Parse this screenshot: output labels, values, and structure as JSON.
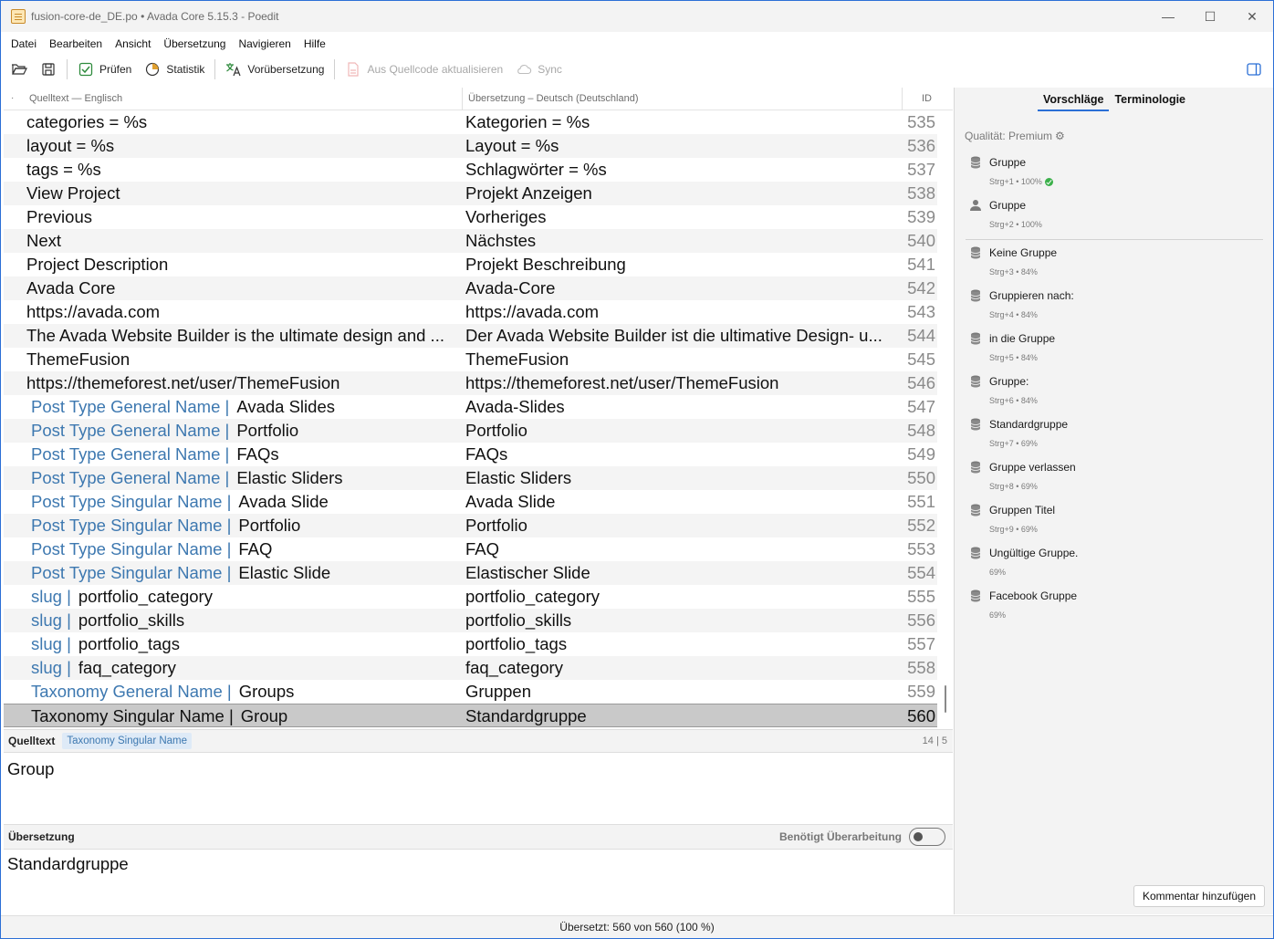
{
  "window": {
    "title": "fusion-core-de_DE.po • Avada Core 5.15.3 - Poedit",
    "controls": {
      "minimize": "—",
      "maximize": "☐",
      "close": "✕"
    }
  },
  "menu": [
    "Datei",
    "Bearbeiten",
    "Ansicht",
    "Übersetzung",
    "Navigieren",
    "Hilfe"
  ],
  "toolbar": {
    "open": {
      "icon": "folder-open-icon"
    },
    "save": {
      "icon": "save-icon"
    },
    "check": {
      "label": "Prüfen",
      "icon": "check-icon"
    },
    "stats": {
      "label": "Statistik",
      "icon": "pie-chart-icon"
    },
    "pretranslate": {
      "label": "Vorübersetzung",
      "icon": "translate-icon"
    },
    "update": {
      "label": "Aus Quellcode aktualisieren",
      "icon": "document-update-icon"
    },
    "sync": {
      "label": "Sync",
      "icon": "cloud-sync-icon"
    },
    "sidebar_toggle": {
      "icon": "sidebar-toggle-icon"
    }
  },
  "list": {
    "headers": {
      "dot": "·",
      "source": "Quelltext — Englisch",
      "translation": "Übersetzung – Deutsch (Deutschland)",
      "id": "ID"
    },
    "rows": [
      {
        "ctx": "",
        "src": "categories = %s",
        "trn": "Kategorien = %s",
        "id": "535"
      },
      {
        "ctx": "",
        "src": "layout = %s",
        "trn": "Layout = %s",
        "id": "536"
      },
      {
        "ctx": "",
        "src": "tags = %s",
        "trn": "Schlagwörter = %s",
        "id": "537"
      },
      {
        "ctx": "",
        "src": "View Project",
        "trn": "Projekt Anzeigen",
        "id": "538"
      },
      {
        "ctx": "",
        "src": "Previous",
        "trn": "Vorheriges",
        "id": "539"
      },
      {
        "ctx": "",
        "src": "Next",
        "trn": "Nächstes",
        "id": "540"
      },
      {
        "ctx": "",
        "src": "Project Description",
        "trn": "Projekt Beschreibung",
        "id": "541"
      },
      {
        "ctx": "",
        "src": "Avada Core",
        "trn": "Avada-Core",
        "id": "542"
      },
      {
        "ctx": "",
        "src": "https://avada.com",
        "trn": "https://avada.com",
        "id": "543"
      },
      {
        "ctx": "",
        "src": "The Avada Website Builder is the ultimate design and ...",
        "trn": "Der Avada Website Builder ist die ultimative Design- u...",
        "id": "544"
      },
      {
        "ctx": "",
        "src": "ThemeFusion",
        "trn": "ThemeFusion",
        "id": "545"
      },
      {
        "ctx": "",
        "src": "https://themeforest.net/user/ThemeFusion",
        "trn": "https://themeforest.net/user/ThemeFusion",
        "id": "546"
      },
      {
        "ctx": "Post Type General Name |",
        "src": "Avada Slides",
        "trn": "Avada-Slides",
        "id": "547"
      },
      {
        "ctx": "Post Type General Name |",
        "src": "Portfolio",
        "trn": "Portfolio",
        "id": "548"
      },
      {
        "ctx": "Post Type General Name |",
        "src": "FAQs",
        "trn": "FAQs",
        "id": "549"
      },
      {
        "ctx": "Post Type General Name |",
        "src": "Elastic Sliders",
        "trn": "Elastic Sliders",
        "id": "550"
      },
      {
        "ctx": "Post Type Singular Name |",
        "src": "Avada Slide",
        "trn": "Avada Slide",
        "id": "551"
      },
      {
        "ctx": "Post Type Singular Name |",
        "src": "Portfolio",
        "trn": "Portfolio",
        "id": "552"
      },
      {
        "ctx": "Post Type Singular Name |",
        "src": "FAQ",
        "trn": "FAQ",
        "id": "553"
      },
      {
        "ctx": "Post Type Singular Name |",
        "src": "Elastic Slide",
        "trn": "Elastischer Slide",
        "id": "554"
      },
      {
        "ctx": "slug |",
        "src": "portfolio_category",
        "trn": "portfolio_category",
        "id": "555"
      },
      {
        "ctx": "slug |",
        "src": "portfolio_skills",
        "trn": "portfolio_skills",
        "id": "556"
      },
      {
        "ctx": "slug |",
        "src": "portfolio_tags",
        "trn": "portfolio_tags",
        "id": "557"
      },
      {
        "ctx": "slug |",
        "src": "faq_category",
        "trn": "faq_category",
        "id": "558"
      },
      {
        "ctx": "Taxonomy General Name |",
        "src": "Groups",
        "trn": "Gruppen",
        "id": "559"
      },
      {
        "ctx": "Taxonomy Singular Name |",
        "src": "Group",
        "trn": "Standardgruppe",
        "id": "560",
        "selected": true
      }
    ]
  },
  "source_pane": {
    "label": "Quelltext",
    "context": "Taxonomy Singular Name",
    "count": "14 | 5",
    "text": "Group"
  },
  "translation_pane": {
    "label": "Übersetzung",
    "needs_work_label": "Benötigt Überarbeitung",
    "text": "Standardgruppe"
  },
  "status": "Übersetzt: 560 von 560 (100 %)",
  "sidebar": {
    "tabs": [
      "Vorschläge",
      "Terminologie"
    ],
    "active_tab": 0,
    "quality": "Qualität: Premium",
    "suggestions": [
      {
        "text": "Gruppe",
        "meta": "Strg+1 • 100%",
        "icon": "database-icon",
        "check": true
      },
      {
        "text": "Gruppe",
        "meta": "Strg+2 • 100%",
        "icon": "person-icon"
      },
      {
        "text": "Keine Gruppe",
        "meta": "Strg+3 • 84%",
        "icon": "database-icon"
      },
      {
        "text": "Gruppieren nach:",
        "meta": "Strg+4 • 84%",
        "icon": "database-icon"
      },
      {
        "text": "in die Gruppe",
        "meta": "Strg+5 • 84%",
        "icon": "database-icon"
      },
      {
        "text": "Gruppe:",
        "meta": "Strg+6 • 84%",
        "icon": "database-icon"
      },
      {
        "text": "Standardgruppe",
        "meta": "Strg+7 • 69%",
        "icon": "database-icon"
      },
      {
        "text": "Gruppe verlassen",
        "meta": "Strg+8 • 69%",
        "icon": "database-icon"
      },
      {
        "text": "Gruppen Titel",
        "meta": "Strg+9 • 69%",
        "icon": "database-icon"
      },
      {
        "text": "Ungültige Gruppe.",
        "meta": "69%",
        "icon": "database-icon"
      },
      {
        "text": "Facebook Gruppe",
        "meta": "69%",
        "icon": "database-icon"
      }
    ],
    "comment_button": "Kommentar hinzufügen"
  }
}
